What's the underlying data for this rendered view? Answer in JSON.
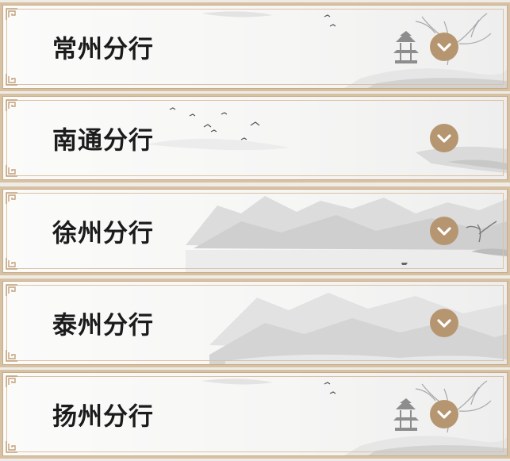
{
  "branches": [
    {
      "name": "常州分行"
    },
    {
      "name": "南通分行"
    },
    {
      "name": "徐州分行"
    },
    {
      "name": "泰州分行"
    },
    {
      "name": "扬州分行"
    }
  ],
  "icons": {
    "toggle": "chevron-down-icon",
    "corner": "fret-corner-ornament"
  },
  "colors": {
    "frame": "#d7c1a3",
    "toggle_bg": "#b69670",
    "text": "#1b1b1b",
    "ink": "#9a9a9a"
  }
}
